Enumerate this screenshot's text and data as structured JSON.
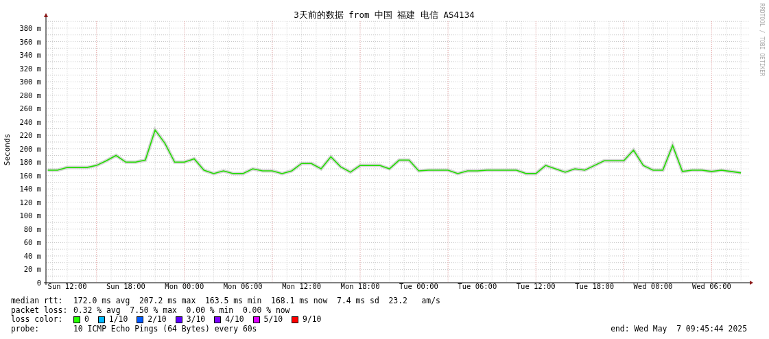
{
  "credit": "RRDTOOL / TOBI OETIKER",
  "chart": {
    "chart_data": {
      "type": "line",
      "title": "3天前的数据 from 中国 福建 电信 AS4134",
      "ylabel": "Seconds",
      "categories": [
        null,
        null,
        "Sun 12:00",
        null,
        null,
        null,
        null,
        null,
        "Sun 18:00",
        null,
        null,
        null,
        null,
        null,
        "Mon 00:00",
        null,
        null,
        null,
        null,
        null,
        "Mon 06:00",
        null,
        null,
        null,
        null,
        null,
        "Mon 12:00",
        null,
        null,
        null,
        null,
        null,
        "Mon 18:00",
        null,
        null,
        null,
        null,
        null,
        "Tue 00:00",
        null,
        null,
        null,
        null,
        null,
        "Tue 06:00",
        null,
        null,
        null,
        null,
        null,
        "Tue 12:00",
        null,
        null,
        null,
        null,
        null,
        "Tue 18:00",
        null,
        null,
        null,
        null,
        null,
        "Wed 00:00",
        null,
        null,
        null,
        null,
        null,
        "Wed 06:00",
        null,
        null,
        null
      ],
      "series": [
        {
          "color": "#22dd00",
          "values": [
            168,
            168,
            172,
            172,
            172,
            175,
            182,
            190,
            180,
            180,
            183,
            228,
            208,
            180,
            180,
            185,
            168,
            163,
            167,
            163,
            163,
            170,
            167,
            167,
            163,
            167,
            178,
            178,
            170,
            188,
            173,
            165,
            175,
            175,
            175,
            170,
            183,
            183,
            167,
            168,
            168,
            168,
            163,
            167,
            167,
            168,
            168,
            168,
            168,
            163,
            163,
            175,
            170,
            165,
            170,
            168,
            175,
            182,
            182,
            182,
            198,
            175,
            168,
            168,
            205,
            166,
            168,
            168,
            166,
            168,
            166,
            164
          ]
        }
      ],
      "ylim": [
        0,
        390
      ],
      "grid": true,
      "yticks": [
        {
          "value": 0,
          "label": "0"
        },
        {
          "value": 20,
          "label": "20 m"
        },
        {
          "value": 40,
          "label": "40 m"
        },
        {
          "value": 60,
          "label": "60 m"
        },
        {
          "value": 80,
          "label": "80 m"
        },
        {
          "value": 100,
          "label": "100 m"
        },
        {
          "value": 120,
          "label": "120 m"
        },
        {
          "value": 140,
          "label": "140 m"
        },
        {
          "value": 160,
          "label": "160 m"
        },
        {
          "value": 180,
          "label": "180 m"
        },
        {
          "value": 200,
          "label": "200 m"
        },
        {
          "value": 220,
          "label": "220 m"
        },
        {
          "value": 240,
          "label": "240 m"
        },
        {
          "value": 260,
          "label": "260 m"
        },
        {
          "value": 280,
          "label": "280 m"
        },
        {
          "value": 300,
          "label": "300 m"
        },
        {
          "value": 320,
          "label": "320 m"
        },
        {
          "value": 340,
          "label": "340 m"
        },
        {
          "value": 360,
          "label": "360 m"
        },
        {
          "value": 380,
          "label": "380 m"
        }
      ]
    }
  },
  "stats": [
    {
      "label": "median rtt:",
      "value": "172.0 ms avg  207.2 ms max  163.5 ms min  168.1 ms now  7.4 ms sd  23.2   am/s"
    },
    {
      "label": "packet loss:",
      "value": "0.32 % avg  7.50 % max  0.00 % min  0.00 % now"
    }
  ],
  "loss_color": {
    "label": "loss color:",
    "items": [
      {
        "label": "0",
        "color": "#26ff00"
      },
      {
        "label": "1/10",
        "color": "#00b8ff"
      },
      {
        "label": "2/10",
        "color": "#0059ff"
      },
      {
        "label": "3/10",
        "color": "#5e00ff"
      },
      {
        "label": "4/10",
        "color": "#7e00ff"
      },
      {
        "label": "5/10",
        "color": "#dd00ff"
      },
      {
        "label": "9/10",
        "color": "#ff0000"
      }
    ]
  },
  "probe": {
    "label": "probe:",
    "value": "10 ICMP Echo Pings (64 Bytes) every 60s"
  },
  "end": "end: Wed May  7 09:45:44 2025"
}
